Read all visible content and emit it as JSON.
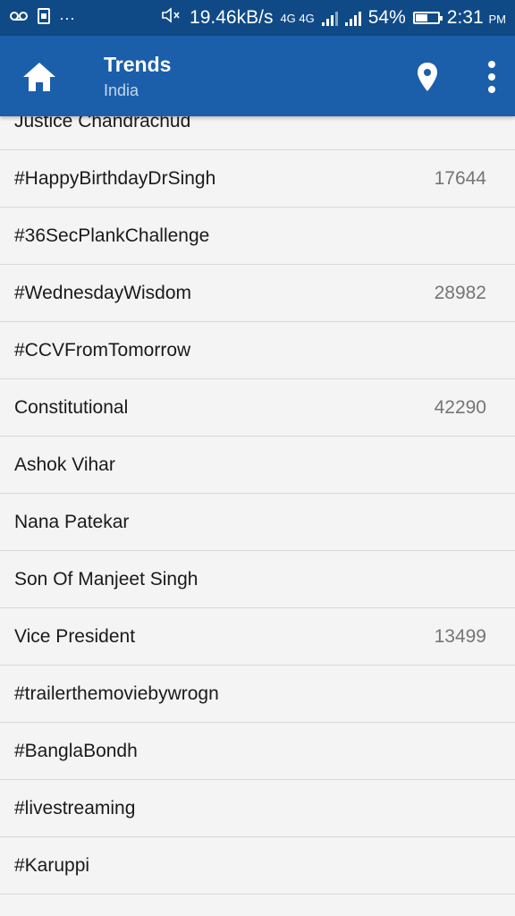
{
  "status_bar": {
    "left_icons": [
      "voicemail-icon",
      "image-notification-icon",
      "more-notifications-icon"
    ],
    "more_dots": "···",
    "mute_icon": "volume-mute-icon",
    "speed": "19.46kB/s",
    "network_label": "4G 4G",
    "battery_percent": "54%",
    "battery_level": 0.54,
    "time": "2:31",
    "time_suffix": "PM"
  },
  "app_bar": {
    "title": "Trends",
    "subtitle": "India",
    "home_icon": "home-icon",
    "location_icon": "location-pin-icon",
    "menu_icon": "more-vert-icon"
  },
  "trends": [
    {
      "name": "Justice Chandrachud",
      "count": ""
    },
    {
      "name": "#HappyBirthdayDrSingh",
      "count": "17644"
    },
    {
      "name": "#36SecPlankChallenge",
      "count": ""
    },
    {
      "name": "#WednesdayWisdom",
      "count": "28982"
    },
    {
      "name": "#CCVFromTomorrow",
      "count": ""
    },
    {
      "name": "Constitutional",
      "count": "42290"
    },
    {
      "name": "Ashok Vihar",
      "count": ""
    },
    {
      "name": "Nana Patekar",
      "count": ""
    },
    {
      "name": "Son Of Manjeet Singh",
      "count": ""
    },
    {
      "name": "Vice President",
      "count": "13499"
    },
    {
      "name": "#trailerthemoviebywrogn",
      "count": ""
    },
    {
      "name": "#BanglaBondh",
      "count": ""
    },
    {
      "name": "#livestreaming",
      "count": ""
    },
    {
      "name": "#Karuppi",
      "count": ""
    }
  ],
  "colors": {
    "status_bar": "#0f4a86",
    "app_bar": "#1b5faa",
    "background": "#f4f4f4",
    "divider": "#d8d8d8"
  }
}
